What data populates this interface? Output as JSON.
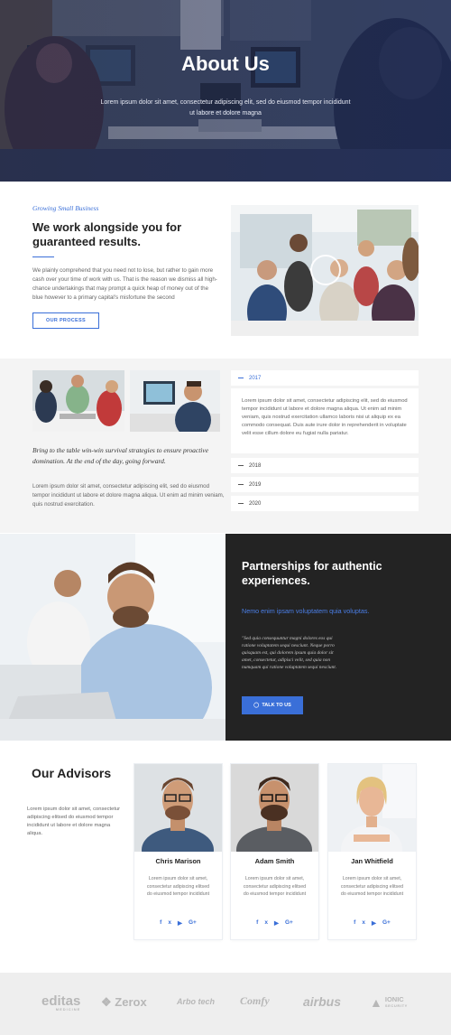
{
  "hero": {
    "title": "About Us",
    "subtitle": "Lorem ipsum dolor sit amet, consectetur adipiscing elit, sed do eiusmod tempor incididunt ut labore et dolore magna"
  },
  "intro": {
    "eyebrow": "Growing Small Business",
    "title": "We work alongside you for guaranteed results.",
    "text": "We plainly comprehend that you need not to lose, but rather to gain more cash over your time of work with us. That is the reason we dismiss all high-chance undertakings that may prompt a quick heap of money out of the blue however to a primary capital's misfortune the second",
    "button_label": "OUR PROCESS"
  },
  "timeline": {
    "quote": "Bring to the table win-win survival strategies to ensure proactive domination. At the end of the day, going forward.",
    "text": "Lorem ipsum dolor sit amet, consectetur adipiscing elit, sed do eiusmod tempor incididunt ut labore et dolore magna aliqua. Ut enim ad minim veniam, quis nostrud exercitation.",
    "accordion": [
      {
        "year": "2017",
        "open": true
      },
      {
        "year": "2018",
        "open": false
      },
      {
        "year": "2019",
        "open": false
      },
      {
        "year": "2020",
        "open": false
      }
    ],
    "open_body": "Lorem ipsum dolor sit amet, consectetur adipiscing elit, sed do eiusmod tempor incididunt ut labore et dolore magna aliqua. Ut enim ad minim veniam, quis nostrud exercitation ullamco laboris nisi ut aliquip ex ea commodo consequat. Duis aute irure dolor in reprehenderit in voluptate velit esse cillum dolore eu fugiat nulla pariatur."
  },
  "partner": {
    "title": "Partnerships for authentic experiences.",
    "subtitle": "Nemo enim ipsam voluptatem quia voluptas.",
    "quote": "\"Sed quia consequuntur magni dolores eos qui ratione voluptatem sequi nesciunt. Neque porro quisquam est, qui dolorem ipsum quia dolor sit amet, consectetur, adipisci velit, sed quia non numquam qui ratione voluptatem sequi nesciunt.",
    "button_label": "TALK TO US"
  },
  "advisors": {
    "heading": "Our Advisors",
    "intro": "Lorem ipsum dolor sit amet, consectetur adipiscing elitsed do eiusmod tempor incididunt ut labore et dolore magna aliqua.",
    "members": [
      {
        "name": "Chris Marison",
        "bio": "Lorem ipsum dolor sit amet, consectetur adipiscing elitsed do eiusmod tempor incididunt"
      },
      {
        "name": "Adam Smith",
        "bio": "Lorem ipsum dolor sit amet, consectetur adipiscing elitsed do eiusmod tempor incididunt"
      },
      {
        "name": "Jan Whitfield",
        "bio": "Lorem ipsum dolor sit amet, consectetur adipiscing elitsed do eiusmod tempor incididunt"
      }
    ],
    "social_icons": [
      "facebook-icon",
      "twitter-icon",
      "youtube-icon",
      "google-plus-icon"
    ]
  },
  "logos": [
    {
      "name": "editas",
      "tagline": "MEDICINE"
    },
    {
      "name": "Zerox"
    },
    {
      "name": "Arbo tech"
    },
    {
      "name": "Comfy"
    },
    {
      "name": "airbus"
    },
    {
      "name": "IONIC",
      "tagline": "SECURITY"
    }
  ],
  "colors": {
    "accent": "#3a6fd8",
    "dark_panel": "#232323",
    "light_bg": "#f4f4f4",
    "logo_grey": "#b7b7b7"
  }
}
